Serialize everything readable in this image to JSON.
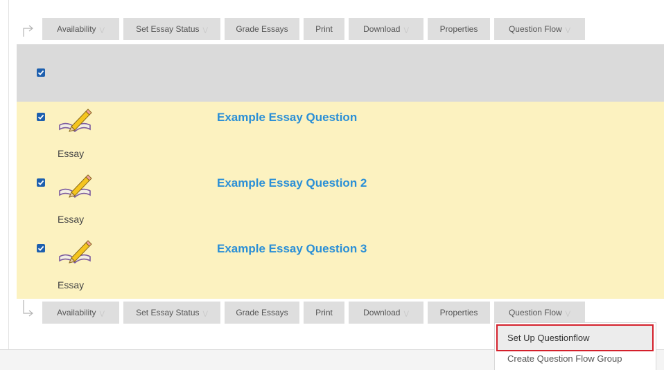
{
  "toolbar": {
    "buttons": [
      {
        "label": "Availability",
        "has_menu": true
      },
      {
        "label": "Set Essay Status",
        "has_menu": true
      },
      {
        "label": "Grade Essays",
        "has_menu": false
      },
      {
        "label": "Print",
        "has_menu": false
      },
      {
        "label": "Download",
        "has_menu": true
      },
      {
        "label": "Properties",
        "has_menu": false
      },
      {
        "label": "Question Flow",
        "has_menu": true
      }
    ]
  },
  "select_all_checked": true,
  "questions": [
    {
      "title": "Example Essay Question",
      "type_label": "Essay",
      "checked": true
    },
    {
      "title": "Example Essay Question 2",
      "type_label": "Essay",
      "checked": true
    },
    {
      "title": "Example Essay Question 3",
      "type_label": "Essay",
      "checked": true
    }
  ],
  "question_flow_menu": {
    "items": [
      {
        "label": "Set Up Questionflow",
        "highlighted": true
      },
      {
        "label": "Create Question Flow Group",
        "highlighted": false
      }
    ]
  },
  "colors": {
    "toolbar_button_bg": "#dedede",
    "header_row_bg": "#dadada",
    "question_row_bg": "#fcf2c0",
    "question_title": "#2a8fd6",
    "checkbox": "#1d5fae",
    "highlight_border": "#d4202b"
  },
  "icons": {
    "toolbar_arrow": "arrow-right-icon",
    "menu_chevron": "chevron-down-icon",
    "question_type": "essay-book-pencil-icon",
    "checkbox": "checkmark-icon"
  }
}
